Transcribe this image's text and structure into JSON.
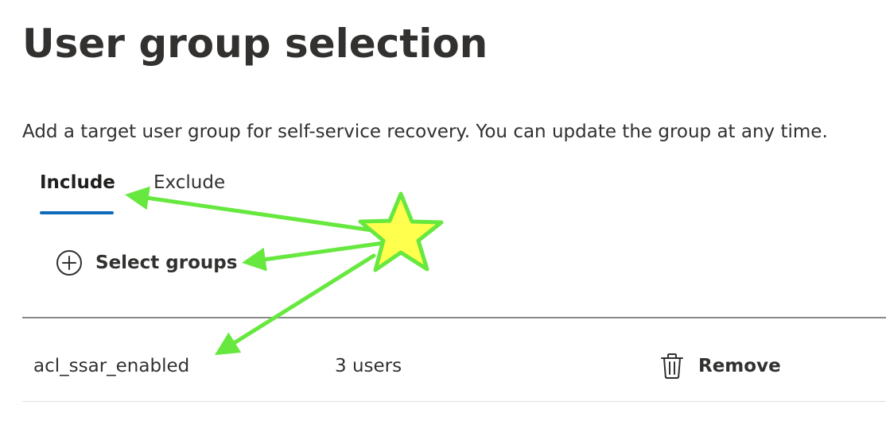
{
  "page": {
    "title": "User group selection",
    "description": "Add a target user group for self-service recovery. You can update the group at any time."
  },
  "tabs": [
    {
      "label": "Include",
      "selected": true
    },
    {
      "label": "Exclude",
      "selected": false
    }
  ],
  "actions": {
    "select_groups_label": "Select groups",
    "select_groups_icon": "add-circle-icon"
  },
  "groups": [
    {
      "name": "acl_ssar_enabled",
      "member_count": "3 users",
      "remove_label": "Remove",
      "remove_icon": "trash-icon"
    }
  ],
  "colors": {
    "tab_underline": "#0f6cbd",
    "text": "#323130",
    "annotation_stroke": "#66e83f",
    "annotation_star_fill": "#ffff4d"
  },
  "annotation": {
    "shape": "star",
    "arrow_targets": [
      "tab-include",
      "select-groups-button",
      "group-row"
    ]
  }
}
